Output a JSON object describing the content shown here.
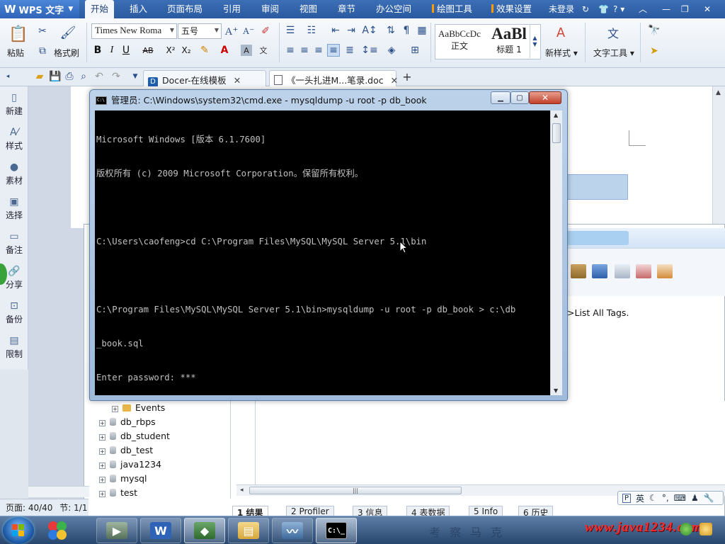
{
  "wps": {
    "app_name": "WPS 文字",
    "menu_tabs": [
      "开始",
      "插入",
      "页面布局",
      "引用",
      "审阅",
      "视图",
      "章节",
      "办公空间"
    ],
    "menu_tabs_extra": [
      "绘图工具",
      "效果设置"
    ],
    "login_label": "未登录",
    "help_label": "?"
  },
  "ribbon": {
    "paste_label": "粘贴",
    "format_painter_label": "格式刷",
    "font_name": "Times New Roma",
    "font_size": "五号",
    "style_normal_sample": "AaBbCcDc",
    "style_normal_label": "正文",
    "style_h1_sample": "AaBl",
    "style_h1_label": "标题 1",
    "new_style_label": "新样式",
    "text_tools_label": "文字工具"
  },
  "tabbar": {
    "tabs": [
      {
        "label": "Docer-在线模板"
      },
      {
        "label": "《一头扎进M...笔录.doc"
      }
    ],
    "new_tab_label": "+"
  },
  "sidebar": {
    "items": [
      {
        "label": "新建",
        "icon": "new-icon"
      },
      {
        "label": "样式",
        "icon": "style-icon"
      },
      {
        "label": "素材",
        "icon": "material-icon"
      },
      {
        "label": "选择",
        "icon": "select-icon"
      },
      {
        "label": "备注",
        "icon": "note-icon"
      },
      {
        "label": "分享",
        "icon": "share-icon"
      },
      {
        "label": "备份",
        "icon": "backup-icon"
      },
      {
        "label": "限制",
        "icon": "restrict-icon"
      }
    ]
  },
  "cmd": {
    "title": "管理员: C:\\Windows\\system32\\cmd.exe - mysqldump  -u root -p db_book",
    "lines": [
      "Microsoft Windows [版本 6.1.7600]",
      "版权所有 (c) 2009 Microsoft Corporation。保留所有权利。",
      "",
      "C:\\Users\\caofeng>cd C:\\Program Files\\MySQL\\MySQL Server 5.1\\bin",
      "",
      "C:\\Program Files\\MySQL\\MySQL Server 5.1\\bin>mysqldump -u root -p db_book > c:\\db",
      "_book.sql",
      "Enter password: ***"
    ]
  },
  "mysql": {
    "list_tags_label": ">List All Tags.",
    "tree": [
      {
        "label": "Events",
        "kind": "folder"
      },
      {
        "label": "db_rbps",
        "kind": "db"
      },
      {
        "label": "db_student",
        "kind": "db"
      },
      {
        "label": "db_test",
        "kind": "db"
      },
      {
        "label": "java1234",
        "kind": "db"
      },
      {
        "label": "mysql",
        "kind": "db"
      },
      {
        "label": "test",
        "kind": "db"
      }
    ],
    "bottom_tabs": [
      "1 结果",
      "2 Profiler",
      "3 信息",
      "4 表数据",
      "5 Info",
      "6 历史"
    ]
  },
  "ime": {
    "lang_label": "英"
  },
  "status": {
    "page_label": "页面: 40/40",
    "section_label": "节: 1/1"
  },
  "taskbar": {
    "signature_text": "考 察 马 克",
    "site_watermark": "www.java1234.com"
  },
  "colors": {
    "cmd_text": "#c0c0c0",
    "cmd_bg": "#000000",
    "wps_menubar": "#2a5aa0",
    "watermark_red": "#ff2a2a"
  }
}
